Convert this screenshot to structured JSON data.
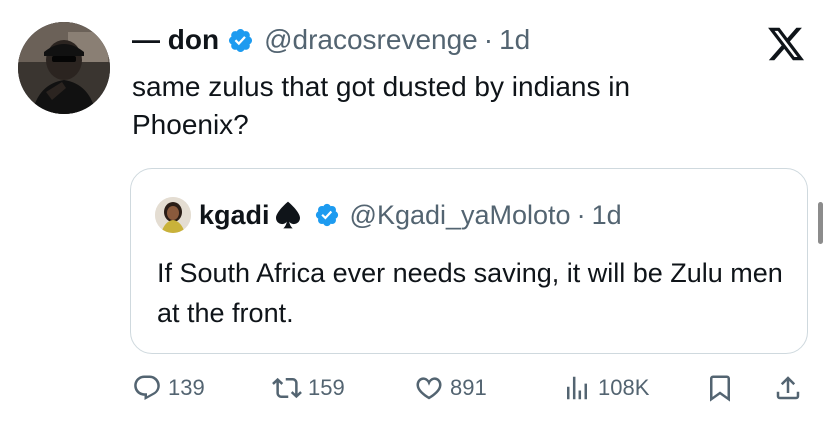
{
  "tweet": {
    "name": "— don",
    "handle": "@dracosrevenge",
    "separator": "·",
    "time": "1d",
    "text": "same zulus that got dusted by indians in Phoenix?"
  },
  "quoted": {
    "name": "kgadi",
    "handle": "@Kgadi_yaMoloto",
    "separator": "·",
    "time": "1d",
    "text": "If South Africa ever needs saving, it will be Zulu men at the front."
  },
  "actions": {
    "replies": "139",
    "retweets": "159",
    "likes": "891",
    "views": "108K"
  },
  "icons": {
    "verified": "verified-badge-icon",
    "spade": "spade-icon",
    "platform": "x-logo-icon",
    "reply": "reply-icon",
    "retweet": "retweet-icon",
    "like": "heart-icon",
    "views": "views-icon",
    "bookmark": "bookmark-icon",
    "share": "share-icon"
  },
  "colors": {
    "verified": "#1d9bf0",
    "secondary_text": "#536471"
  }
}
